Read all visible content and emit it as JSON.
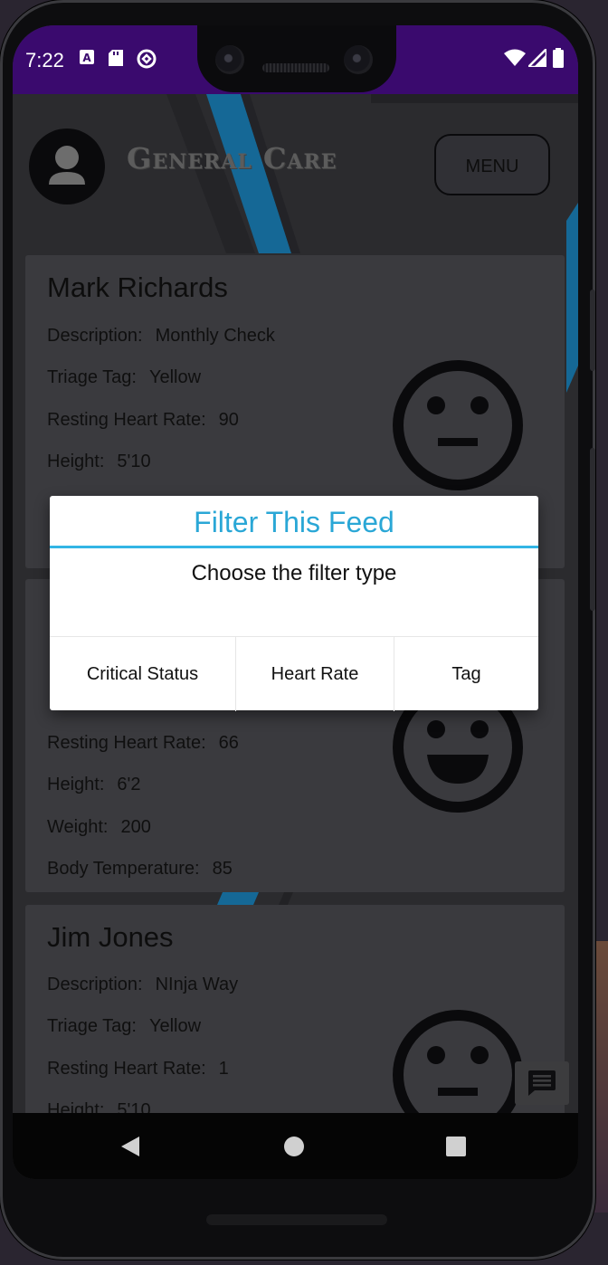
{
  "status_bar": {
    "time": "7:22"
  },
  "header": {
    "title": "General Care",
    "menu_label": "MENU"
  },
  "cards": [
    {
      "name": "Mark Richards",
      "fields": [
        {
          "label": "Description:",
          "value": "Monthly Check"
        },
        {
          "label": "Triage Tag:",
          "value": "Yellow"
        },
        {
          "label": "Resting Heart Rate:",
          "value": "90"
        },
        {
          "label": "Height:",
          "value": "5'10"
        }
      ],
      "face": "neutral"
    },
    {
      "fields": [
        {
          "label": "Resting Heart Rate:",
          "value": "66"
        },
        {
          "label": "Height:",
          "value": "6'2"
        },
        {
          "label": "Weight:",
          "value": "200"
        },
        {
          "label": "Body Temperature:",
          "value": "85"
        }
      ],
      "face": "happy"
    },
    {
      "name": "Jim Jones",
      "fields": [
        {
          "label": "Description:",
          "value": "NInja Way"
        },
        {
          "label": "Triage Tag:",
          "value": "Yellow"
        },
        {
          "label": "Resting Heart Rate:",
          "value": "1"
        },
        {
          "label": "Height:",
          "value": "5'10"
        }
      ],
      "face": "neutral"
    }
  ],
  "dialog": {
    "title": "Filter This Feed",
    "message": "Choose the filter type",
    "buttons": [
      "Critical Status",
      "Heart Rate",
      "Tag"
    ]
  },
  "colors": {
    "accent": "#33b5e5",
    "status_bar": "#3a0a6e",
    "card": "#4b4b50"
  },
  "icons": {
    "fab": "chat-icon",
    "nav": [
      "back-icon",
      "home-icon",
      "recents-icon"
    ]
  }
}
